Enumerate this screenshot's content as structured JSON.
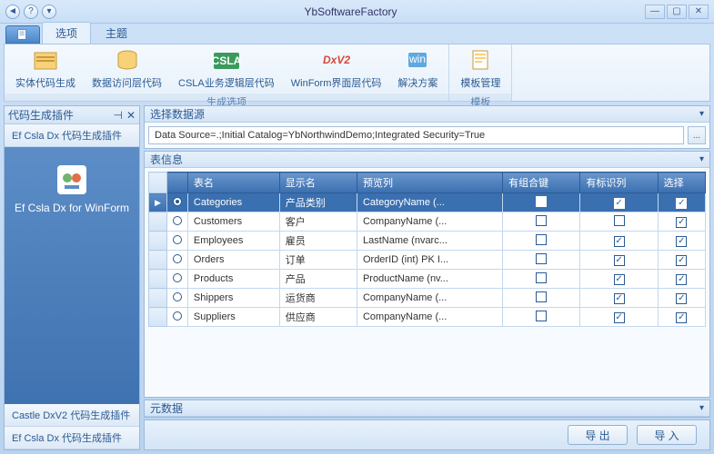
{
  "app": {
    "title": "YbSoftwareFactory"
  },
  "tabs": {
    "options": "选项",
    "theme": "主题"
  },
  "ribbon": {
    "group_gen": "生成选项",
    "group_tpl": "模板",
    "items": {
      "entity": "实体代码生成",
      "dal": "数据访问层代码",
      "csla": "CSLA业务逻辑层代码",
      "winform": "WinForm界面层代码",
      "solution": "解决方案",
      "template": "模板管理"
    }
  },
  "left": {
    "title": "代码生成插件",
    "items": {
      "efcsladx": "Ef Csla Dx 代码生成插件",
      "castle": "Castle DxV2 代码生成插件",
      "efcsladx2": "Ef Csla Dx 代码生成插件"
    },
    "plugin": "Ef Csla Dx for WinForm"
  },
  "ds": {
    "title": "选择数据源",
    "value": "Data Source=.;Initial Catalog=YbNorthwindDemo;Integrated Security=True",
    "btn": "..."
  },
  "tableinfo": {
    "title": "表信息"
  },
  "columns": {
    "name": "表名",
    "display": "显示名",
    "preview": "预览列",
    "composite": "有组合键",
    "identity": "有标识列",
    "select": "选择"
  },
  "rows": [
    {
      "name": "Categories",
      "display": "产品类别",
      "preview": "CategoryName (...",
      "composite": false,
      "identity": true,
      "select": true,
      "selected": true
    },
    {
      "name": "Customers",
      "display": "客户",
      "preview": "CompanyName (...",
      "composite": false,
      "identity": false,
      "select": true
    },
    {
      "name": "Employees",
      "display": "雇员",
      "preview": "LastName (nvarc...",
      "composite": false,
      "identity": true,
      "select": true
    },
    {
      "name": "Orders",
      "display": "订单",
      "preview": "OrderID (int) PK I...",
      "composite": false,
      "identity": true,
      "select": true
    },
    {
      "name": "Products",
      "display": "产品",
      "preview": "ProductName (nv...",
      "composite": false,
      "identity": true,
      "select": true
    },
    {
      "name": "Shippers",
      "display": "运货商",
      "preview": "CompanyName (...",
      "composite": false,
      "identity": true,
      "select": true
    },
    {
      "name": "Suppliers",
      "display": "供应商",
      "preview": "CompanyName (...",
      "composite": false,
      "identity": true,
      "select": true
    }
  ],
  "meta": {
    "title": "元数据"
  },
  "footer": {
    "export": "导 出",
    "import": "导 入"
  }
}
